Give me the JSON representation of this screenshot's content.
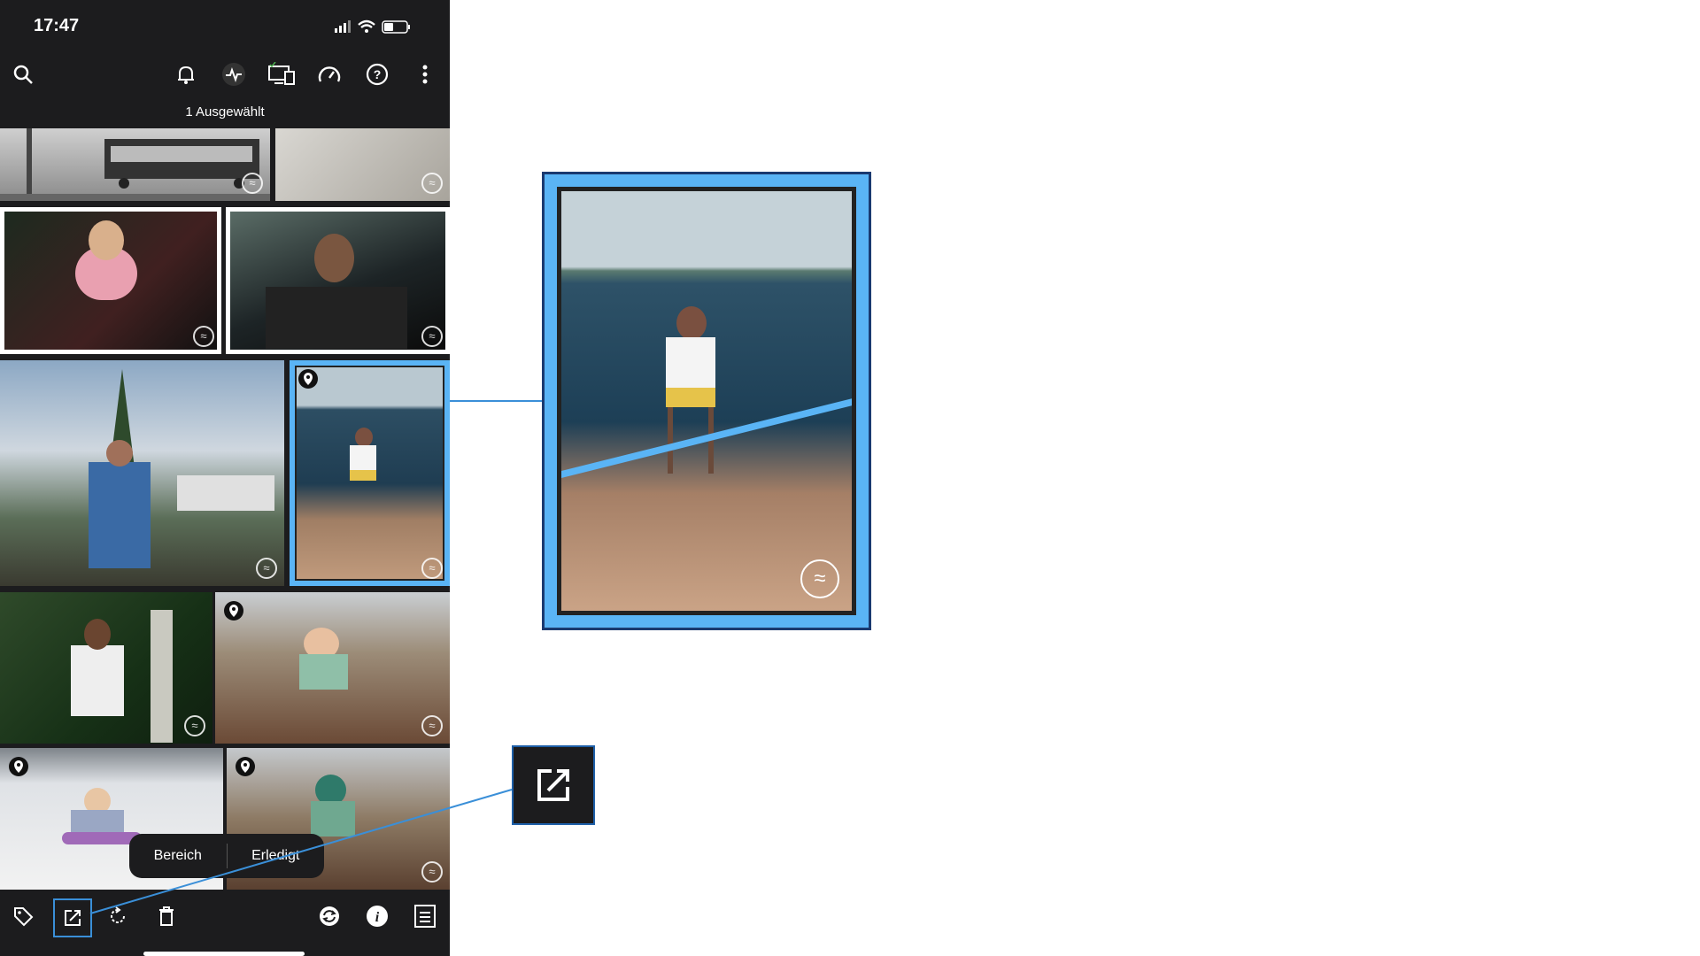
{
  "status_bar": {
    "time": "17:47"
  },
  "header": {
    "selection_label": "1 Ausgewählt"
  },
  "toolbar_icons": [
    "search-icon",
    "bell-icon",
    "activity-icon",
    "devices-icon",
    "speedometer-icon",
    "help-icon",
    "more-icon"
  ],
  "popup": {
    "area_label": "Bereich",
    "done_label": "Erledigt"
  },
  "bottom_icons": [
    "tag-icon",
    "open-external-icon",
    "rotate-icon",
    "trash-icon",
    "sync-icon",
    "info-icon",
    "list-icon"
  ],
  "colors": {
    "selection": "#5ab4f5",
    "bar_bg": "#1c1c1e",
    "callout": "#3a8fd8"
  }
}
